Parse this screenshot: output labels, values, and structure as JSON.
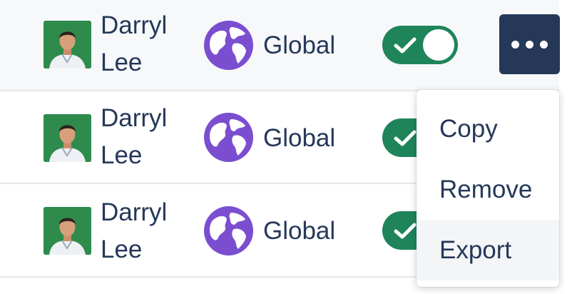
{
  "rows": [
    {
      "name_first": "Darryl",
      "name_last": "Lee",
      "region": "Global",
      "avatar_icon": "person-photo-icon",
      "region_icon": "globe-icon",
      "enabled": true
    },
    {
      "name_first": "Darryl",
      "name_last": "Lee",
      "region": "Global",
      "avatar_icon": "person-photo-icon",
      "region_icon": "globe-icon",
      "enabled": true
    },
    {
      "name_first": "Darryl",
      "name_last": "Lee",
      "region": "Global",
      "avatar_icon": "person-photo-icon",
      "region_icon": "globe-icon",
      "enabled": true
    }
  ],
  "actions_button": {
    "icon": "more-horizontal-icon"
  },
  "menu": {
    "items": [
      {
        "label": "Copy"
      },
      {
        "label": "Remove"
      },
      {
        "label": "Export"
      }
    ],
    "highlighted": "Export"
  },
  "colors": {
    "text": "#253858",
    "toggle_on": "#1f845a",
    "globe": "#7b4ed0",
    "button_dark": "#253858",
    "row_highlight": "#f7f8fa"
  }
}
